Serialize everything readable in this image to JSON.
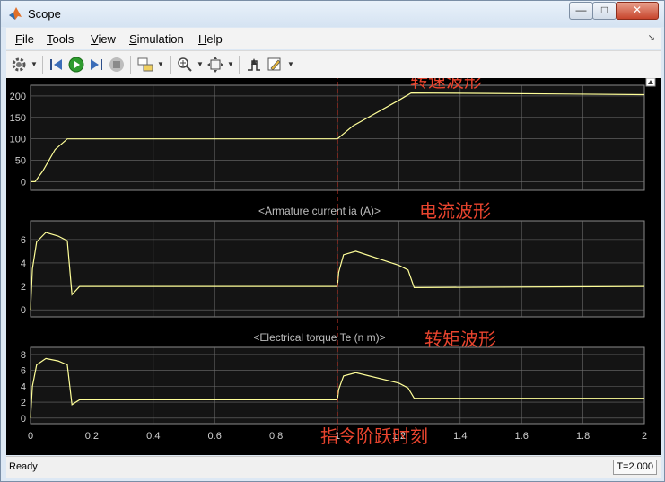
{
  "window": {
    "title": "Scope",
    "min": "—",
    "max": "□",
    "close": "✕"
  },
  "menu": {
    "items": [
      {
        "first": "F",
        "rest": "ile"
      },
      {
        "first": "T",
        "rest": "ools"
      },
      {
        "first": "V",
        "rest": "iew"
      },
      {
        "first": "S",
        "rest": "imulation"
      },
      {
        "first": "H",
        "rest": "elp"
      }
    ],
    "overflow": "↘"
  },
  "status": {
    "ready": "Ready",
    "time": "T=2.000"
  },
  "colors": {
    "plot_bg": "#000000",
    "axes_bg": "#141414",
    "grid": "#6e6e6e",
    "trace": "#ffff99",
    "marker": "#d53a2d",
    "annot": "#e8442e"
  },
  "chart_data": [
    {
      "type": "line",
      "title": "",
      "xlim": [
        0,
        2
      ],
      "ylim": [
        -20,
        225
      ],
      "yticks": [
        0,
        50,
        100,
        150,
        200
      ],
      "x": [
        0,
        0.015,
        0.04,
        0.08,
        0.12,
        0.9,
        1.0,
        1.05,
        1.2,
        1.24,
        1.5,
        2.0
      ],
      "y": [
        0,
        0,
        25,
        75,
        100,
        100,
        100,
        130,
        190,
        207,
        206,
        203
      ]
    },
    {
      "type": "line",
      "title": "<Armature current ia (A)>",
      "xlim": [
        0,
        2
      ],
      "ylim": [
        -0.6,
        7.6
      ],
      "yticks": [
        0,
        2,
        4,
        6
      ],
      "x": [
        0,
        0.006,
        0.02,
        0.05,
        0.09,
        0.12,
        0.135,
        0.16,
        1.0,
        1.004,
        1.02,
        1.06,
        1.2,
        1.23,
        1.25,
        2.0
      ],
      "y": [
        0,
        3.5,
        5.8,
        6.6,
        6.3,
        5.9,
        1.3,
        2.0,
        2.0,
        3.2,
        4.7,
        5.0,
        3.8,
        3.4,
        1.9,
        2.0
      ]
    },
    {
      "type": "line",
      "title": "<Electrical torque Te (n m)>",
      "xlim": [
        0,
        2
      ],
      "ylim": [
        -0.7,
        8.9
      ],
      "yticks": [
        0,
        2,
        4,
        6,
        8
      ],
      "x": [
        0,
        0.006,
        0.02,
        0.05,
        0.09,
        0.12,
        0.135,
        0.16,
        1.0,
        1.004,
        1.02,
        1.06,
        1.2,
        1.23,
        1.25,
        2.0
      ],
      "y": [
        0,
        4.0,
        6.7,
        7.5,
        7.2,
        6.7,
        1.7,
        2.3,
        2.3,
        3.6,
        5.3,
        5.7,
        4.4,
        3.8,
        2.5,
        2.5
      ],
      "xticks": [
        0,
        0.2,
        0.4,
        0.6,
        0.8,
        1,
        1.2,
        1.4,
        1.6,
        1.8,
        2
      ]
    }
  ],
  "annotations": {
    "speed": "转速波形",
    "current": "电流波形",
    "torque": "转矩波形",
    "step": "指令阶跃时刻"
  },
  "step_time": 1.0
}
